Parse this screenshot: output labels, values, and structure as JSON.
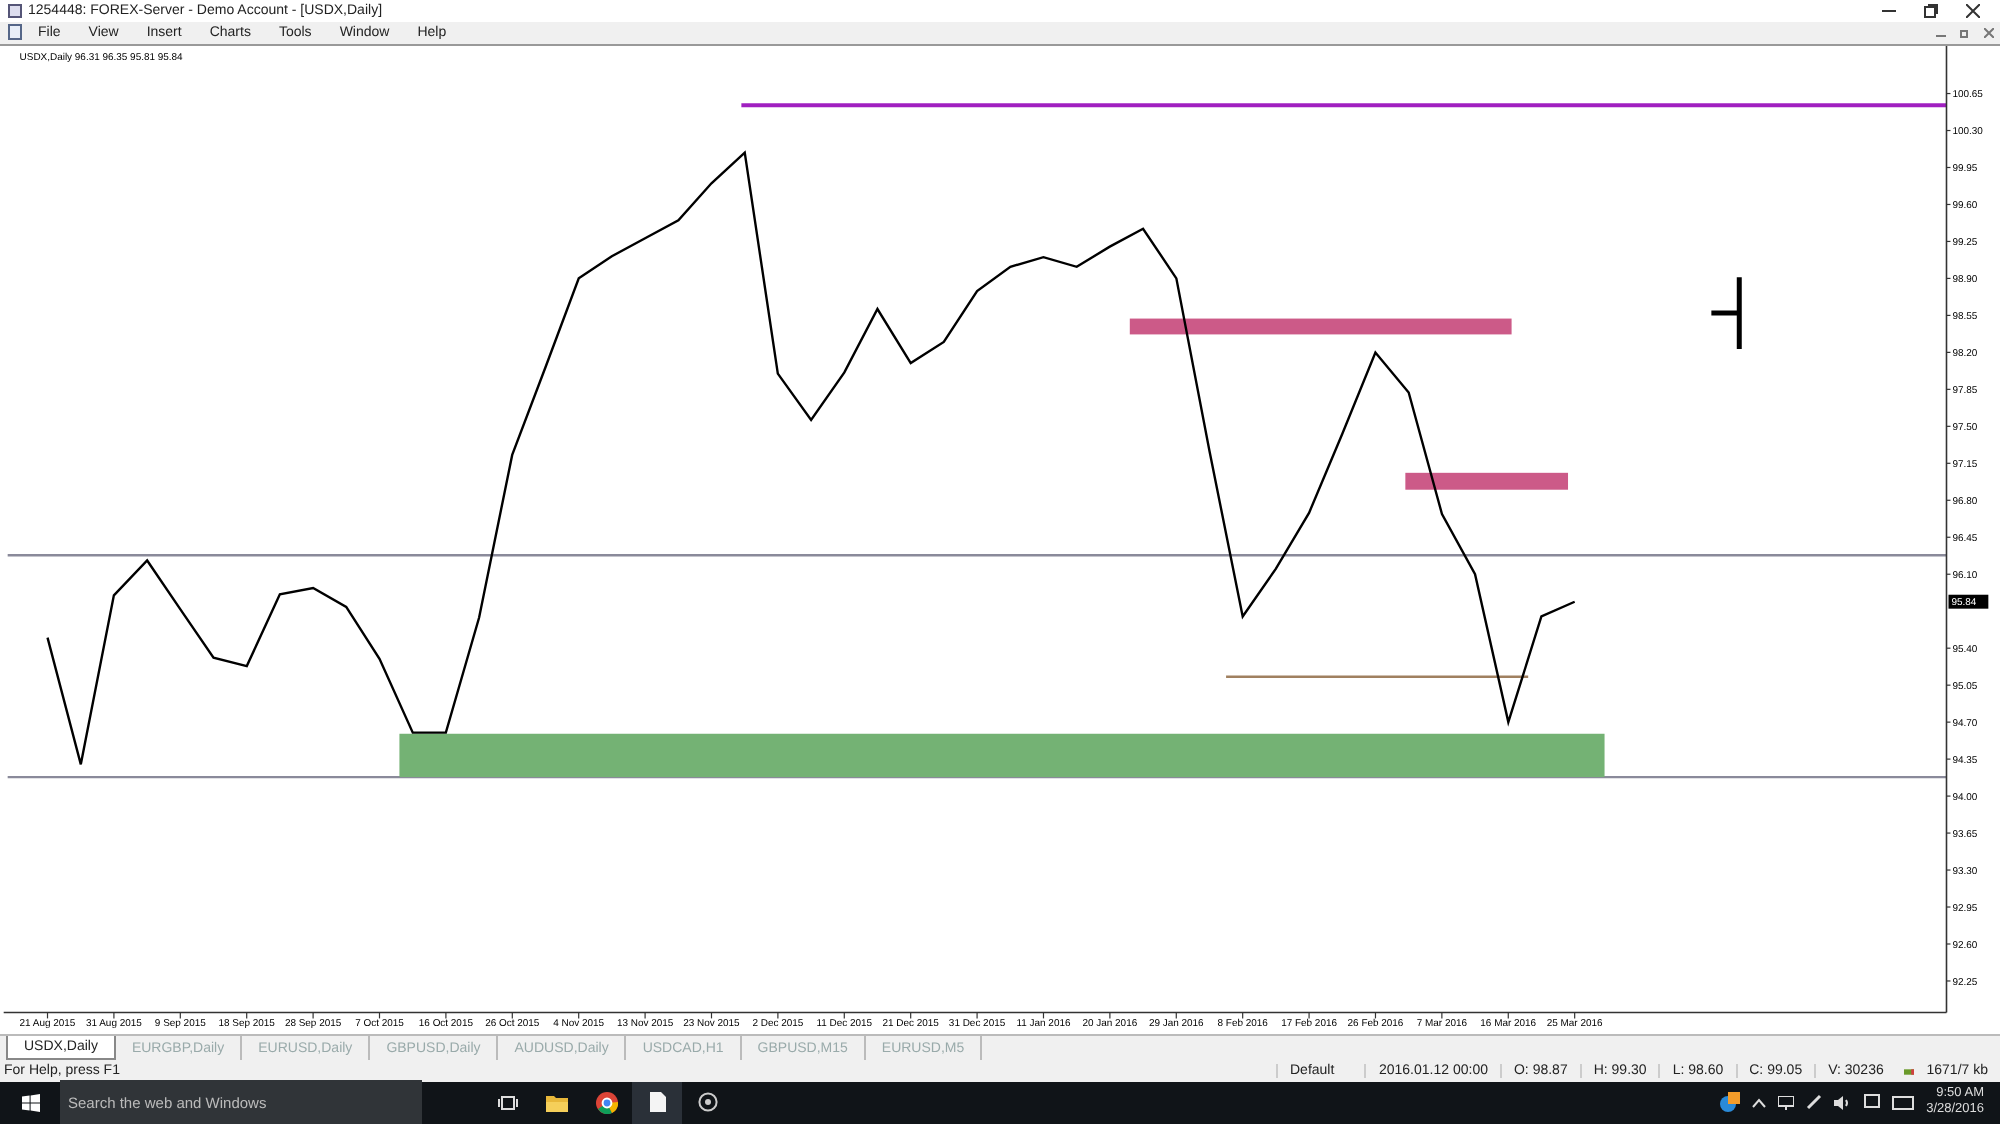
{
  "window": {
    "title": "1254448: FOREX-Server - Demo Account - [USDX,Daily]"
  },
  "menu": [
    "File",
    "View",
    "Insert",
    "Charts",
    "Tools",
    "Window",
    "Help"
  ],
  "chart": {
    "header": "USDX,Daily  96.31 96.35 95.81 95.84",
    "price_tag": "95.84",
    "chart_data": {
      "type": "line",
      "ylim": [
        91.99,
        101.1
      ],
      "categories": [
        "21 Aug 2015",
        null,
        "31 Aug 2015",
        null,
        "9 Sep 2015",
        null,
        "18 Sep 2015",
        null,
        "28 Sep 2015",
        null,
        "7 Oct 2015",
        null,
        "16 Oct 2015",
        null,
        "26 Oct 2015",
        null,
        "4 Nov 2015",
        null,
        "13 Nov 2015",
        null,
        "23 Nov 2015",
        null,
        "2 Dec 2015",
        null,
        "11 Dec 2015",
        null,
        "21 Dec 2015",
        null,
        "31 Dec 2015",
        null,
        "11 Jan 2016",
        null,
        "20 Jan 2016",
        null,
        "29 Jan 2016",
        null,
        "8 Feb 2016",
        null,
        "17 Feb 2016",
        null,
        "26 Feb 2016",
        null,
        "7 Mar 2016",
        null,
        "16 Mar 2016",
        null,
        "25 Mar 2016"
      ],
      "series": [
        {
          "color": "#000000",
          "values": [
            95.5,
            94.3,
            95.9,
            96.23,
            95.77,
            95.31,
            95.23,
            95.91,
            95.97,
            95.79,
            95.3,
            94.6,
            94.6,
            95.69,
            97.23,
            98.06,
            98.9,
            99.11,
            99.28,
            99.45,
            99.8,
            100.09,
            98.0,
            97.56,
            98.01,
            98.61,
            98.1,
            98.3,
            98.78,
            99.01,
            99.1,
            99.01,
            99.2,
            99.37,
            98.9,
            97.27,
            95.7,
            96.15,
            96.68,
            97.43,
            98.2,
            97.82,
            96.67,
            96.1,
            94.7,
            95.7,
            95.84
          ]
        }
      ],
      "yticks": [
        {
          "value": 100.65,
          "label": "100.65"
        },
        {
          "value": 100.3,
          "label": "100.30"
        },
        {
          "value": 99.95,
          "label": "99.95"
        },
        {
          "value": 99.6,
          "label": "99.60"
        },
        {
          "value": 99.25,
          "label": "99.25"
        },
        {
          "value": 98.9,
          "label": "98.90"
        },
        {
          "value": 98.55,
          "label": "98.55"
        },
        {
          "value": 98.2,
          "label": "98.20"
        },
        {
          "value": 97.85,
          "label": "97.85"
        },
        {
          "value": 97.5,
          "label": "97.50"
        },
        {
          "value": 97.15,
          "label": "97.15"
        },
        {
          "value": 96.8,
          "label": "96.80"
        },
        {
          "value": 96.45,
          "label": "96.45"
        },
        {
          "value": 96.1,
          "label": "96.10"
        },
        {
          "value": 95.4,
          "label": "95.40"
        },
        {
          "value": 95.05,
          "label": "95.05"
        },
        {
          "value": 94.7,
          "label": "94.70"
        },
        {
          "value": 94.35,
          "label": "94.35"
        },
        {
          "value": 94.0,
          "label": "94.00"
        },
        {
          "value": 93.65,
          "label": "93.65"
        },
        {
          "value": 93.3,
          "label": "93.30"
        },
        {
          "value": 92.95,
          "label": "92.95"
        },
        {
          "value": 92.6,
          "label": "92.60"
        },
        {
          "value": 92.25,
          "label": "92.25"
        }
      ],
      "ref_lines": [
        {
          "axis": "y",
          "value": 96.28,
          "color": "#8a8a9a"
        },
        {
          "axis": "y",
          "value": 94.18,
          "color": "#8a8a9a"
        },
        {
          "axis": "y",
          "value": 100.54,
          "color": "#a020c0"
        },
        {
          "axis": "y",
          "value": 95.13,
          "color": "#a08060"
        }
      ],
      "bands": [
        {
          "axis": "y",
          "from": 98.37,
          "to": 98.52,
          "color": "#cc5a88"
        },
        {
          "axis": "y",
          "from": 96.9,
          "to": 97.06,
          "color": "#cc5a88"
        },
        {
          "axis": "y",
          "from": 94.18,
          "to": 94.59,
          "color": "#74b274"
        }
      ]
    }
  },
  "tabs": [
    {
      "label": "USDX,Daily",
      "selected": true
    },
    {
      "label": "EURGBP,Daily",
      "selected": false
    },
    {
      "label": "EURUSD,Daily",
      "selected": false
    },
    {
      "label": "GBPUSD,Daily",
      "selected": false
    },
    {
      "label": "AUDUSD,Daily",
      "selected": false
    },
    {
      "label": "USDCAD,H1",
      "selected": false
    },
    {
      "label": "GBPUSD,M15",
      "selected": false
    },
    {
      "label": "EURUSD,M5",
      "selected": false
    }
  ],
  "status_bar": {
    "help": "For Help, press F1",
    "profile": "Default",
    "time": "2016.01.12 00:00",
    "open": "O: 98.87",
    "high": "H: 99.30",
    "low": "L: 98.60",
    "close": "C: 99.05",
    "volume": "V: 30236",
    "traffic": "1671/7 kb"
  },
  "taskbar": {
    "search_placeholder": "Search the web and Windows",
    "time": "9:50 AM",
    "date": "3/28/2016"
  }
}
